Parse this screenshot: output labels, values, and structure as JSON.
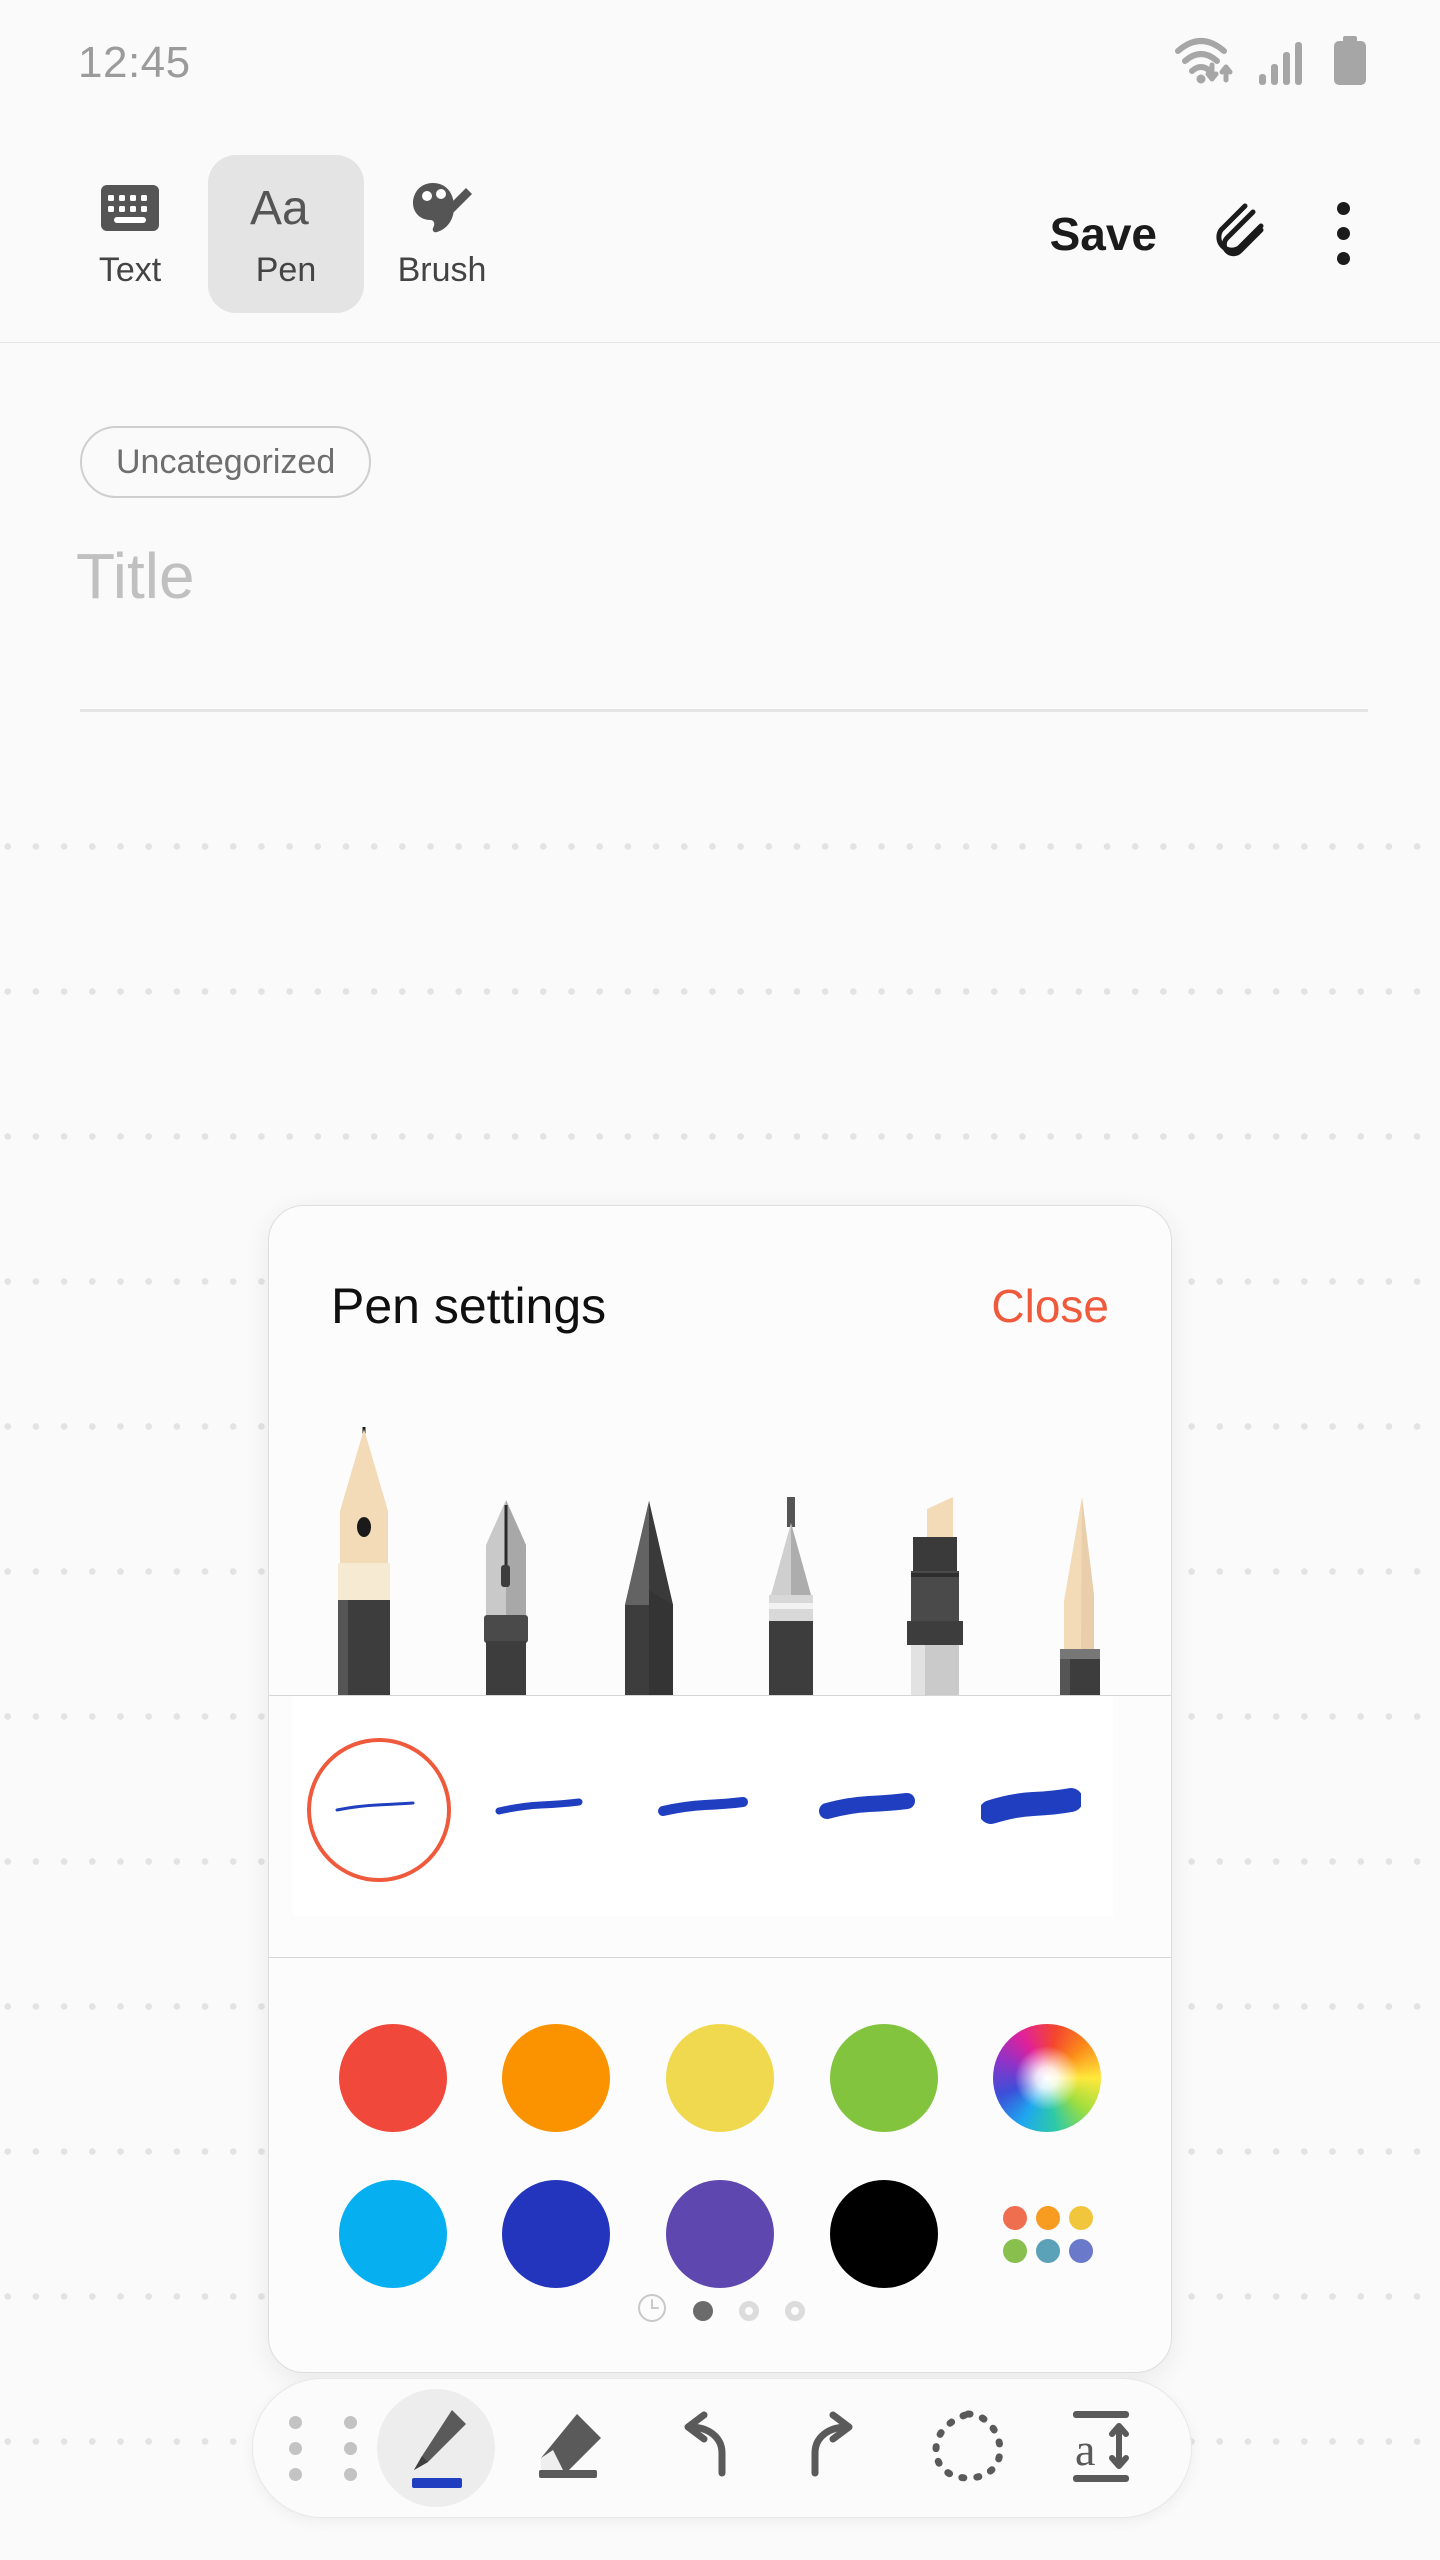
{
  "status_bar": {
    "time": "12:45",
    "icons": [
      "wifi-icon",
      "signal-icon",
      "battery-icon"
    ]
  },
  "top_toolbar": {
    "tabs": [
      {
        "label": "Text",
        "icon": "keyboard-icon",
        "active": false
      },
      {
        "label": "Pen",
        "icon": "text-style-icon",
        "active": true
      },
      {
        "label": "Brush",
        "icon": "palette-brush-icon",
        "active": false
      }
    ],
    "save_label": "Save",
    "attach_icon": "paperclip-icon",
    "more_icon": "more-vertical-icon"
  },
  "note": {
    "category": "Uncategorized",
    "title_placeholder": "Title"
  },
  "pen_settings": {
    "title": "Pen settings",
    "close_label": "Close",
    "pen_types": [
      {
        "name": "fountain-pen",
        "selected": true
      },
      {
        "name": "calligraphy-pen",
        "selected": false
      },
      {
        "name": "pencil",
        "selected": false
      },
      {
        "name": "mechanical-pencil",
        "selected": false
      },
      {
        "name": "marker",
        "selected": false
      },
      {
        "name": "brush-pen",
        "selected": false
      }
    ],
    "stroke_widths": [
      {
        "level": 1,
        "selected": true
      },
      {
        "level": 2,
        "selected": false
      },
      {
        "level": 3,
        "selected": false
      },
      {
        "level": 4,
        "selected": false
      },
      {
        "level": 5,
        "selected": false
      }
    ],
    "stroke_color": "#1f3fc0",
    "selection_ring_color": "#ef5a3c",
    "colors_row1": [
      {
        "name": "red",
        "hex": "#f0483a"
      },
      {
        "name": "orange",
        "hex": "#fb9200"
      },
      {
        "name": "yellow",
        "hex": "#f0d94e"
      },
      {
        "name": "green",
        "hex": "#83c43f"
      },
      {
        "name": "color-wheel",
        "hex": "rainbow"
      }
    ],
    "colors_row2": [
      {
        "name": "light-blue",
        "hex": "#05aff0"
      },
      {
        "name": "blue",
        "hex": "#2435bd"
      },
      {
        "name": "purple",
        "hex": "#5f47b0"
      },
      {
        "name": "black",
        "hex": "#000000"
      },
      {
        "name": "palette-grid",
        "hex": "grid"
      }
    ],
    "palette_grid_colors": [
      "#ef6e50",
      "#f79b21",
      "#f2c63c",
      "#89bf4d",
      "#5ba2b8",
      "#6a79c9"
    ],
    "history_icon": "clock-icon",
    "pages": [
      {
        "active": true
      },
      {
        "active": false
      },
      {
        "active": false
      }
    ]
  },
  "bottom_toolbar": {
    "drag_handle": "drag-handle-icon",
    "items": [
      {
        "name": "pen-tool",
        "icon": "pen-icon",
        "selected": true
      },
      {
        "name": "eraser-tool",
        "icon": "eraser-icon",
        "selected": false
      },
      {
        "name": "undo",
        "icon": "undo-icon",
        "selected": false
      },
      {
        "name": "redo",
        "icon": "redo-icon",
        "selected": false
      },
      {
        "name": "lasso-select",
        "icon": "lasso-icon",
        "selected": false
      },
      {
        "name": "text-convert",
        "icon": "text-convert-icon",
        "selected": false
      }
    ],
    "pen_accent": "#1f3fc0"
  }
}
